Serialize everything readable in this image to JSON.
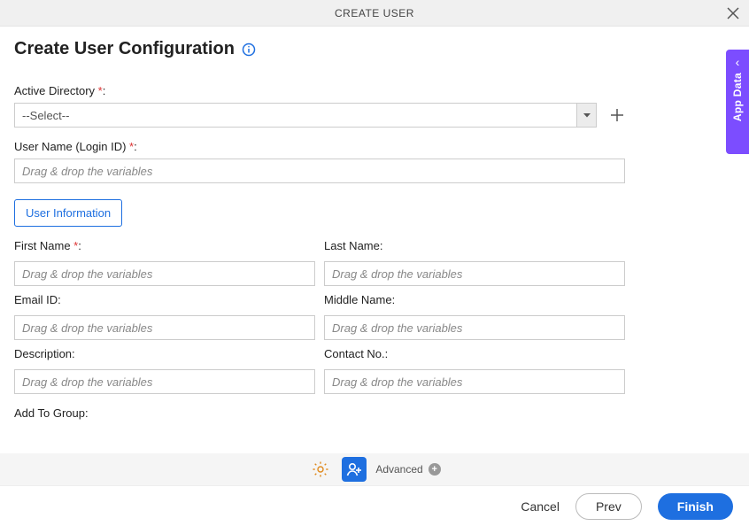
{
  "header": {
    "title": "CREATE USER"
  },
  "page": {
    "title": "Create User Configuration"
  },
  "side_panel": {
    "label": "App Data"
  },
  "fields": {
    "active_directory": {
      "label": "Active Directory ",
      "required": "*",
      "suffix": ":",
      "value": "--Select--"
    },
    "user_name": {
      "label": "User Name (Login ID) ",
      "required": "*",
      "suffix": ":",
      "placeholder": "Drag & drop the variables"
    },
    "tab": "User Information",
    "first_name": {
      "label": "First Name ",
      "required": "*",
      "suffix": ":",
      "placeholder": "Drag & drop the variables"
    },
    "last_name": {
      "label": "Last Name:",
      "placeholder": "Drag & drop the variables"
    },
    "email_id": {
      "label": "Email ID:",
      "placeholder": "Drag & drop the variables"
    },
    "middle_name": {
      "label": "Middle Name:",
      "placeholder": "Drag & drop the variables"
    },
    "description": {
      "label": "Description:",
      "placeholder": "Drag & drop the variables"
    },
    "contact_no": {
      "label": "Contact No.:",
      "placeholder": "Drag & drop the variables"
    },
    "add_to_group": {
      "label": "Add To Group:"
    }
  },
  "toolbar": {
    "advanced": "Advanced"
  },
  "footer": {
    "cancel": "Cancel",
    "prev": "Prev",
    "finish": "Finish"
  }
}
